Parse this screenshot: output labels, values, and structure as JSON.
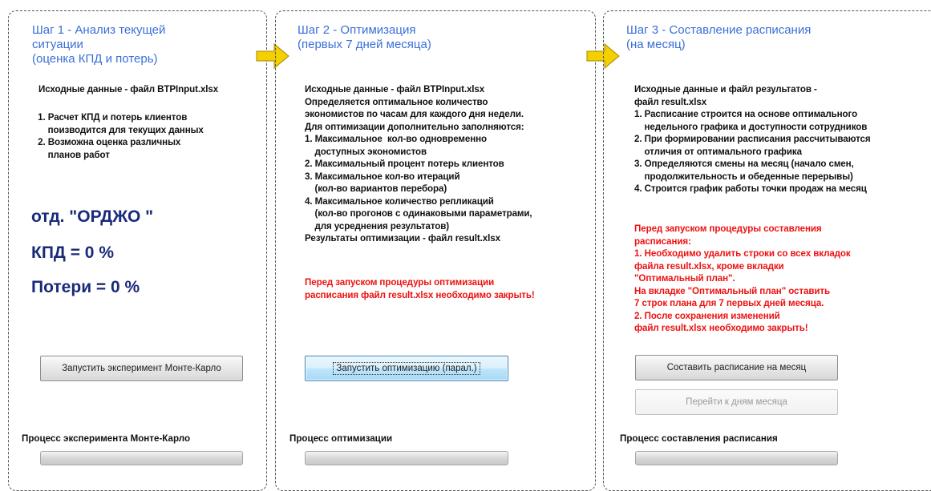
{
  "step1": {
    "title": "Шаг 1 - Анализ текущей\nситуации\n(оценка КПД и потерь)",
    "input_text": "Исходные данные - файл BTPInput.xlsx",
    "items_text": " 1. Расчет КПД и потерь клиентов\n     поизводится для текущих данных\n 2. Возможна оценка различных\n     планов работ",
    "dept": "отд. \"ОРДЖО \"",
    "kpd": "КПД = 0 %",
    "losses": "Потери = 0 %",
    "run_button": "Запустить эксперимент Монте-Карло",
    "progress_label": "Процесс эксперимента Монте-Карло",
    "progress_value": 0
  },
  "step2": {
    "title": "Шаг 2 - Оптимизация\n(первых 7 дней месяца)",
    "body_text": "Исходные данные - файл BTPInput.xlsx\nОпределяется оптимальное количество\nэкономистов по часам для каждого дня недели.\nДля оптимизации дополнительно заполняются:\n1. Максимальное  кол-во одновременно\n    доступных экономистов\n2. Максимальный процент потерь клиентов\n3. Максимальное кол-во итераций\n    (кол-во вариантов перебора)\n4. Максимальное количество репликаций\n    (кол-во прогонов с одинаковыми параметрами,\n    для усреднения результатов)\nРезультаты оптимизации - файл result.xlsx",
    "warning_text": "Перед запуском процедуры оптимизации\nрасписания файл result.xlsx необходимо закрыть!",
    "run_button": "Запустить оптимизацию (парал.)",
    "progress_label": "Процесс оптимизации",
    "progress_value": 0
  },
  "step3": {
    "title": "Шаг 3 - Составление расписания\n(на месяц)",
    "body_text": "Исходные данные и файл результатов -\nфайл result.xlsx\n1. Расписание строится на основе оптимального\n    недельного графика и доступности сотрудников\n2. При формировании расписания рассчитываются\n    отличия от оптимального графика\n3. Определяются смены на месяц (начало смен,\n    продолжительность и обеденные перерывы)\n4. Строится график работы точки продаж на месяц",
    "warning_text": "Перед запуском процедуры составления\nрасписания:\n1. Необходимо удалить строки со всех вкладок\nфайла result.xlsx, кроме вкладки\n\"Оптимальный план\".\nНа вкладке \"Оптимальный план\" оставить\n7 строк плана для 7 первых дней месяца.\n2. После сохранения изменений\nфайл result.xlsx необходимо закрыть!",
    "run_button": "Составить расписание на месяц",
    "days_button": "Перейти к дням месяца",
    "progress_label": "Процесс составления расписания",
    "progress_value": 0
  },
  "colors": {
    "title": "#3a6fd8",
    "big_text": "#1a2a7a",
    "warning": "#ee1111",
    "arrow": "#f5d000"
  }
}
